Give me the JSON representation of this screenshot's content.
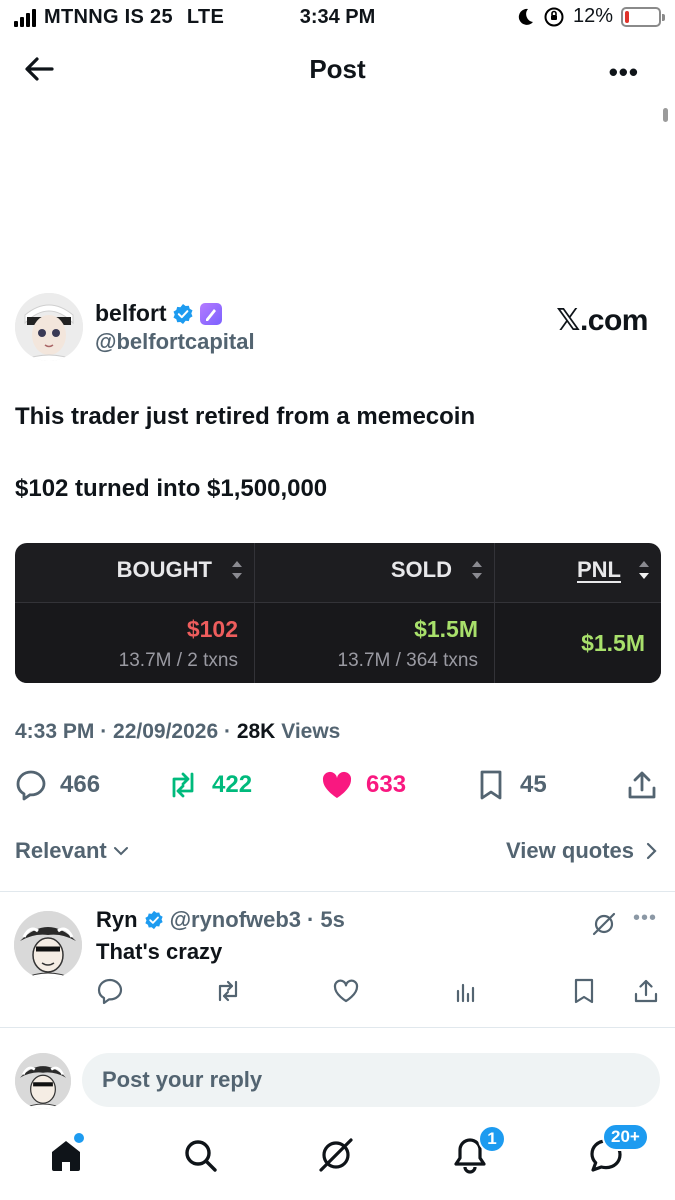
{
  "status_bar": {
    "carrier": "MTNNG IS 25",
    "network": "LTE",
    "time": "3:34 PM",
    "battery": "12%",
    "battery_level": 0.12
  },
  "nav": {
    "title": "Post"
  },
  "post": {
    "author_name": "belfort",
    "author_handle": "@belfortcapital",
    "source": "𝕏.com",
    "text_lines": [
      "This trader just retired from a memecoin",
      "$102 turned into $1,500,000"
    ],
    "table": {
      "headers": [
        "BOUGHT",
        "SOLD",
        "PNL"
      ],
      "bought_value": "$102",
      "bought_sub": "13.7M / 2 txns",
      "sold_value": "$1.5M",
      "sold_sub": "13.7M / 364 txns",
      "pnl_value": "$1.5M"
    },
    "time": "4:33 PM",
    "date": "22/09/2026",
    "views_count": "28K",
    "views_label": "Views",
    "replies": "466",
    "reposts": "422",
    "likes": "633",
    "bookmarks": "45"
  },
  "sort": {
    "relevant_label": "Relevant",
    "view_quotes_label": "View quotes"
  },
  "reply": {
    "name": "Ryn",
    "handle": "@rynofweb3",
    "age": "5s",
    "text": "That's crazy"
  },
  "composer": {
    "placeholder": "Post your reply"
  },
  "tabs": {
    "notifications_badge": "1",
    "messages_badge": "20+"
  },
  "colors": {
    "accent": "#1d9bf0",
    "like": "#f91880",
    "repost": "#00ba7c",
    "muted": "#536471"
  }
}
